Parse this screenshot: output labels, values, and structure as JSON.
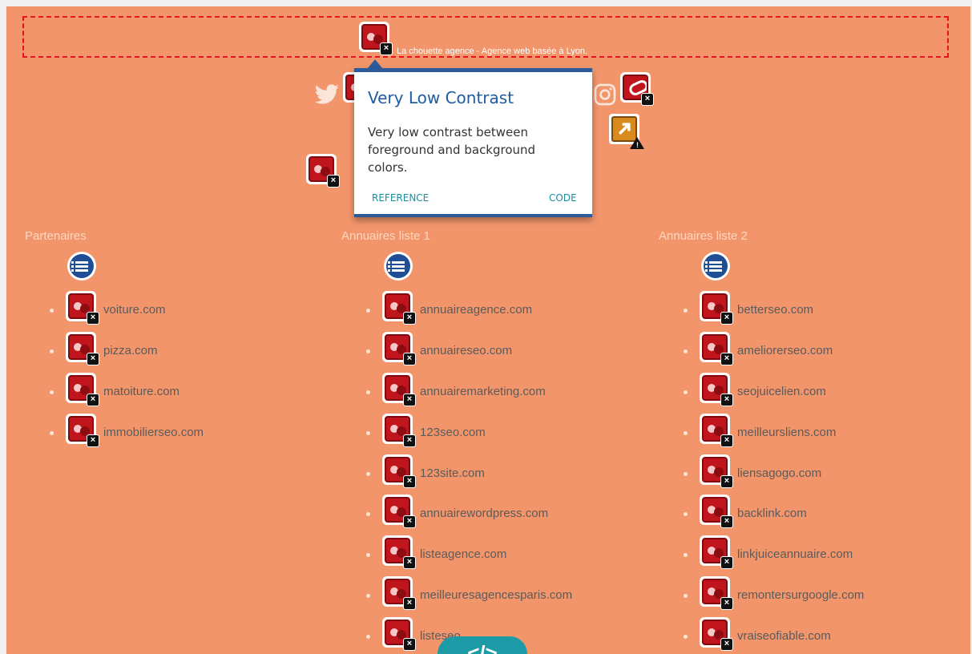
{
  "banner": {
    "text": "La chouette agence - Agence web basée à Lyon."
  },
  "popup": {
    "title": "Very Low Contrast",
    "description": "Very low contrast between foreground and background colors.",
    "reference_label": "REFERENCE",
    "code_label": "CODE"
  },
  "columns": [
    {
      "heading": "Partenaires",
      "items": [
        "voiture.com",
        "pizza.com",
        "matoiture.com",
        "immobilierseo.com"
      ]
    },
    {
      "heading": "Annuaires liste 1",
      "items": [
        "annuaireagence.com",
        "annuaireseo.com",
        "annuairemarketing.com",
        "123seo.com",
        "123site.com",
        "annuairewordpress.com",
        "listeagence.com",
        "meilleuresagencesparis.com",
        "listeseo"
      ]
    },
    {
      "heading": "Annuaires liste 2",
      "items": [
        "betterseo.com",
        "ameliorerseo.com",
        "seojuicelien.com",
        "meilleursliens.com",
        "liensagogo.com",
        "backlink.com",
        "linkjuiceannuaire.com",
        "remontersurgoogle.com",
        "vraiseofiable.com"
      ]
    }
  ],
  "code_toggle": "</>",
  "colors": {
    "background": "#f2956a",
    "error": "#c1151d",
    "popup_accent": "#2d5b9a",
    "link": "#1b8da0"
  },
  "icons": [
    "twitter-icon",
    "instagram-icon",
    "error-icon",
    "broken-link-icon",
    "redirect-warning-icon",
    "list-structure-icon",
    "code-icon"
  ]
}
